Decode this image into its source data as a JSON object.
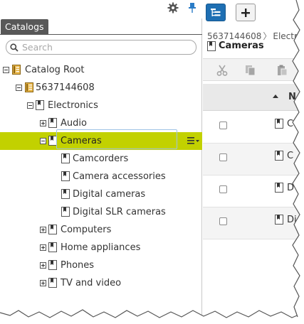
{
  "left_panel": {
    "tab_label": "Catalogs",
    "search": {
      "placeholder": "Search",
      "value": ""
    },
    "tree": [
      {
        "label": "Catalog Root",
        "depth": 0,
        "toggle": "minus",
        "icon": "catalog-root-icon"
      },
      {
        "label": "5637144608",
        "depth": 1,
        "toggle": "minus",
        "icon": "catalog-icon"
      },
      {
        "label": "Electronics",
        "depth": 2,
        "toggle": "minus",
        "icon": "category-icon"
      },
      {
        "label": "Audio",
        "depth": 3,
        "toggle": "plus",
        "icon": "category-icon"
      },
      {
        "label": "Cameras",
        "depth": 3,
        "toggle": "minus",
        "icon": "category-icon",
        "selected": true
      },
      {
        "label": "Camcorders",
        "depth": 4,
        "toggle": "none",
        "icon": "category-icon"
      },
      {
        "label": "Camera accessories",
        "depth": 4,
        "toggle": "none",
        "icon": "category-icon"
      },
      {
        "label": "Digital cameras",
        "depth": 4,
        "toggle": "none",
        "icon": "category-icon"
      },
      {
        "label": "Digital SLR cameras",
        "depth": 4,
        "toggle": "none",
        "icon": "category-icon"
      },
      {
        "label": "Computers",
        "depth": 3,
        "toggle": "plus",
        "icon": "category-icon"
      },
      {
        "label": "Home appliances",
        "depth": 3,
        "toggle": "plus",
        "icon": "category-icon"
      },
      {
        "label": "Phones",
        "depth": 3,
        "toggle": "plus",
        "icon": "category-icon"
      },
      {
        "label": "TV and video",
        "depth": 3,
        "toggle": "plus",
        "icon": "category-icon"
      }
    ]
  },
  "right_panel": {
    "breadcrumb": {
      "parent": "5637144608",
      "separator": "〉",
      "current": "Electro"
    },
    "title": "Cameras",
    "grid": {
      "column_name": "N",
      "rows": [
        {
          "name": "C",
          "checked": false
        },
        {
          "name": "C",
          "checked": false
        },
        {
          "name": "D",
          "checked": false
        },
        {
          "name": "Di",
          "checked": false
        }
      ]
    }
  },
  "colors": {
    "selection_highlight": "#c2d100",
    "tab_background": "#585858",
    "primary_button": "#1e6fb3",
    "focus_outline": "#9fc3e6"
  }
}
